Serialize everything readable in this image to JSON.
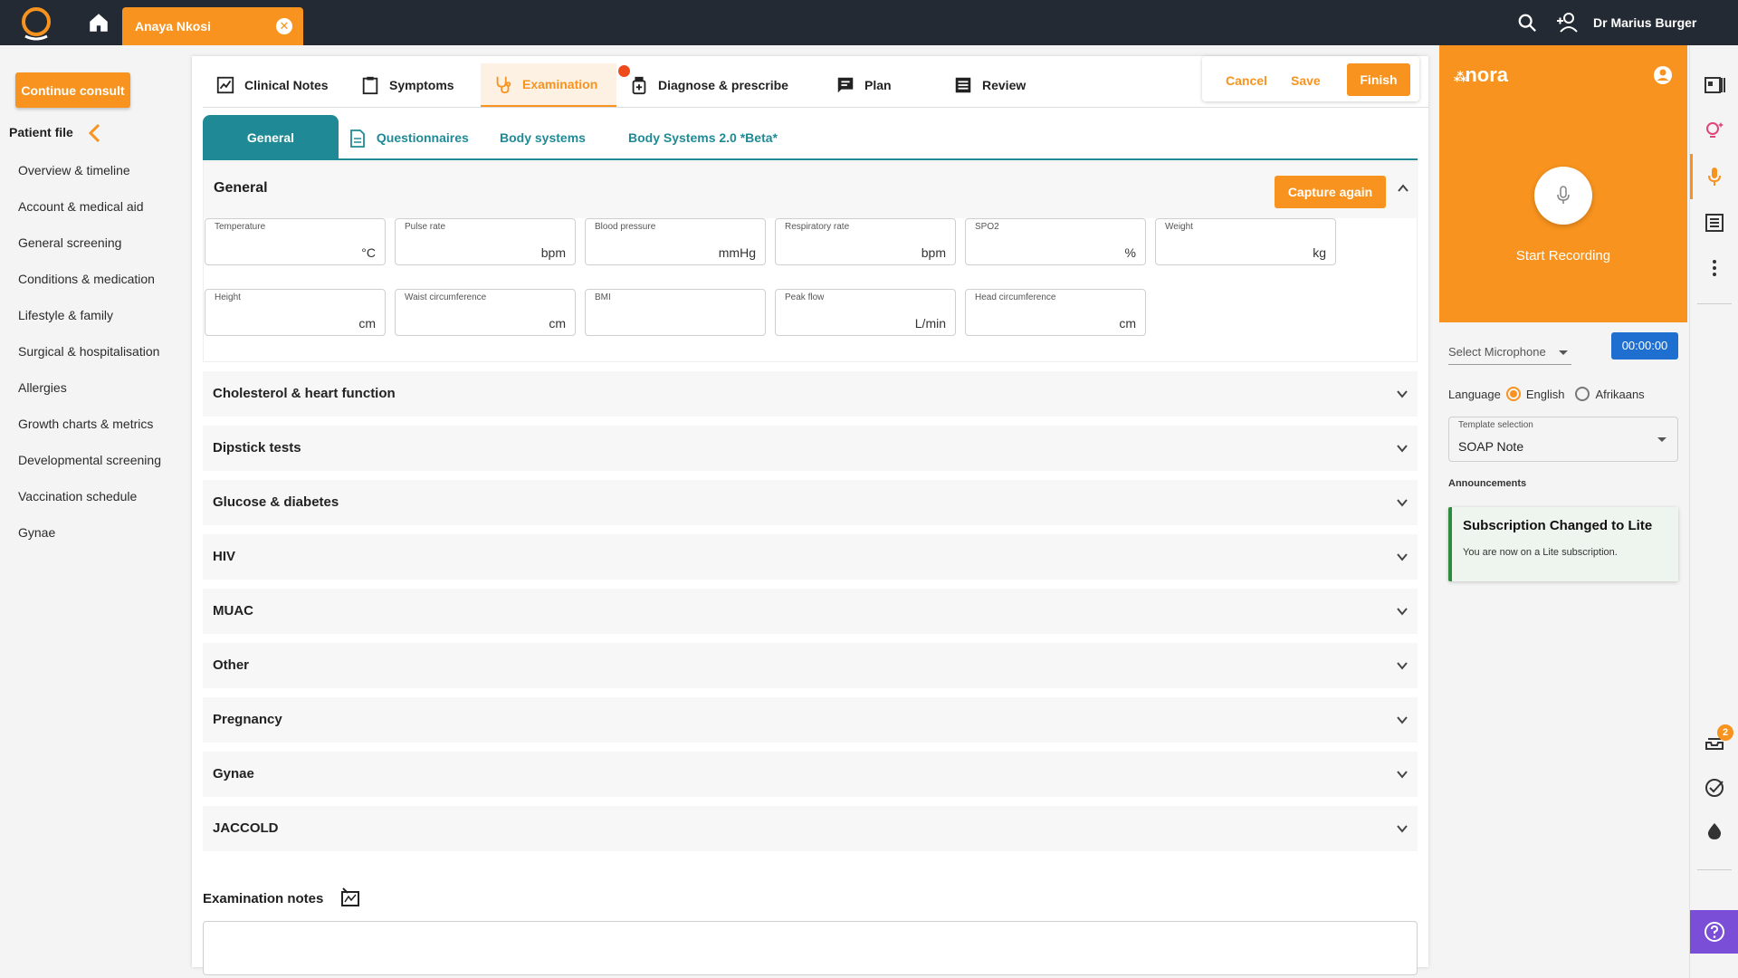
{
  "topbar": {
    "patient_tab": "Anaya Nkosi",
    "user_name": "Dr Marius Burger"
  },
  "sidebar": {
    "continue_label": "Continue consult",
    "patient_file_label": "Patient file",
    "items": [
      {
        "label": "Overview & timeline"
      },
      {
        "label": "Account & medical aid"
      },
      {
        "label": "General screening"
      },
      {
        "label": "Conditions & medication"
      },
      {
        "label": "Lifestyle & family"
      },
      {
        "label": "Surgical & hospitalisation"
      },
      {
        "label": "Allergies"
      },
      {
        "label": "Growth charts & metrics"
      },
      {
        "label": "Developmental screening"
      },
      {
        "label": "Vaccination schedule"
      },
      {
        "label": "Gynae"
      }
    ]
  },
  "tabs": {
    "clinical_notes": "Clinical Notes",
    "symptoms": "Symptoms",
    "examination": "Examination",
    "diagnose": "Diagnose & prescribe",
    "plan": "Plan",
    "review": "Review",
    "active": "Examination"
  },
  "actions": {
    "cancel": "Cancel",
    "save": "Save",
    "finish": "Finish"
  },
  "subtabs": {
    "general": "General",
    "questionnaires": "Questionnaires",
    "body_systems": "Body systems",
    "body_systems_2": "Body Systems 2.0 *Beta*"
  },
  "general": {
    "title": "General",
    "capture_again": "Capture again",
    "fields": [
      {
        "label": "Temperature",
        "unit": "°C",
        "value": ""
      },
      {
        "label": "Pulse rate",
        "unit": "bpm",
        "value": ""
      },
      {
        "label": "Blood pressure",
        "unit": "mmHg",
        "value": ""
      },
      {
        "label": "Respiratory rate",
        "unit": "bpm",
        "value": ""
      },
      {
        "label": "SPO2",
        "unit": "%",
        "value": ""
      },
      {
        "label": "Weight",
        "unit": "kg",
        "value": ""
      },
      {
        "label": "Height",
        "unit": "cm",
        "value": ""
      },
      {
        "label": "Waist circumference",
        "unit": "cm",
        "value": ""
      },
      {
        "label": "BMI",
        "unit": "",
        "value": ""
      },
      {
        "label": "Peak flow",
        "unit": "L/min",
        "value": ""
      },
      {
        "label": "Head circumference",
        "unit": "cm",
        "value": ""
      }
    ]
  },
  "accordions": [
    {
      "title": "Cholesterol & heart function"
    },
    {
      "title": "Dipstick tests"
    },
    {
      "title": "Glucose & diabetes"
    },
    {
      "title": "HIV"
    },
    {
      "title": "MUAC"
    },
    {
      "title": "Other"
    },
    {
      "title": "Pregnancy"
    },
    {
      "title": "Gynae"
    },
    {
      "title": "JACCOLD"
    }
  ],
  "exam_notes": {
    "label": "Examination notes",
    "value": ""
  },
  "nora": {
    "logo": "nora",
    "start_recording": "Start Recording",
    "select_microphone": "Select Microphone",
    "timer": "00:00:00",
    "language_label": "Language",
    "lang_english": "English",
    "lang_afrikaans": "Afrikaans",
    "selected_language": "English",
    "template_label": "Template selection",
    "template_value": "SOAP Note",
    "announcements_label": "Announcements",
    "announcement_title": "Subscription Changed to Lite",
    "announcement_body": "You are now on a Lite subscription."
  },
  "rail": {
    "notifications_count": "2"
  },
  "colors": {
    "accent": "#f7931e",
    "teal": "#1f8a96",
    "topbar": "#232a33",
    "timer": "#1e6fcf",
    "help": "#7a4ed6",
    "notice_dot": "#ef4a1e"
  }
}
